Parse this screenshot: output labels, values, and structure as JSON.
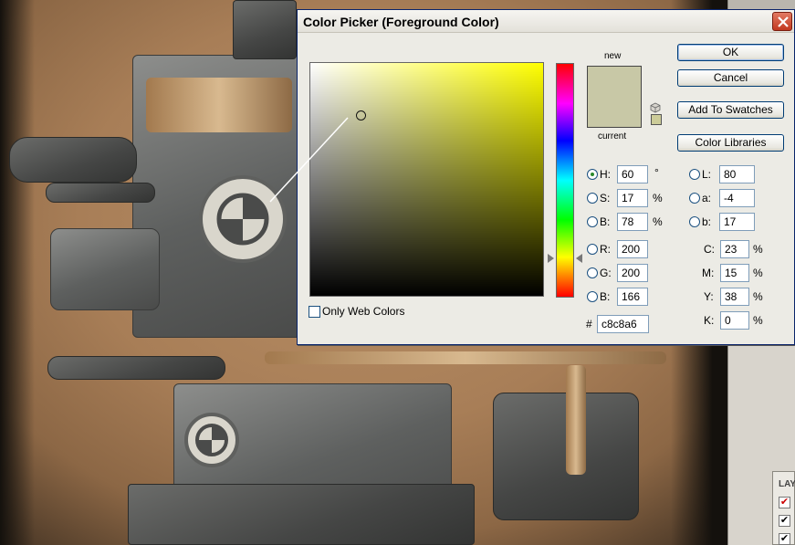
{
  "dialog": {
    "title": "Color Picker (Foreground Color)",
    "new_label": "new",
    "current_label": "current",
    "new_color": "#c8c8a6",
    "current_color": "#c8c8a6",
    "websafe_color": "#cccc99",
    "hue_base_color": "#ffff00",
    "buttons": {
      "ok": "OK",
      "cancel": "Cancel",
      "add_to_swatches": "Add To Swatches",
      "color_libraries": "Color Libraries"
    },
    "hsb": {
      "h": {
        "label": "H:",
        "value": "60",
        "unit": "°",
        "selected": true
      },
      "s": {
        "label": "S:",
        "value": "17",
        "unit": "%"
      },
      "b": {
        "label": "B:",
        "value": "78",
        "unit": "%"
      }
    },
    "rgb": {
      "r": {
        "label": "R:",
        "value": "200"
      },
      "g": {
        "label": "G:",
        "value": "200"
      },
      "b": {
        "label": "B:",
        "value": "166"
      }
    },
    "lab": {
      "l": {
        "label": "L:",
        "value": "80"
      },
      "a": {
        "label": "a:",
        "value": "-4"
      },
      "b": {
        "label": "b:",
        "value": "17"
      }
    },
    "cmyk": {
      "c": {
        "label": "C:",
        "value": "23",
        "unit": "%"
      },
      "m": {
        "label": "M:",
        "value": "15",
        "unit": "%"
      },
      "y": {
        "label": "Y:",
        "value": "38",
        "unit": "%"
      },
      "k": {
        "label": "K:",
        "value": "0",
        "unit": "%"
      }
    },
    "hex": {
      "label": "#",
      "value": "c8c8a6"
    },
    "only_web_colors": {
      "label": "Only Web Colors",
      "checked": false
    }
  },
  "layers_panel": {
    "tab_label": "LAY"
  }
}
